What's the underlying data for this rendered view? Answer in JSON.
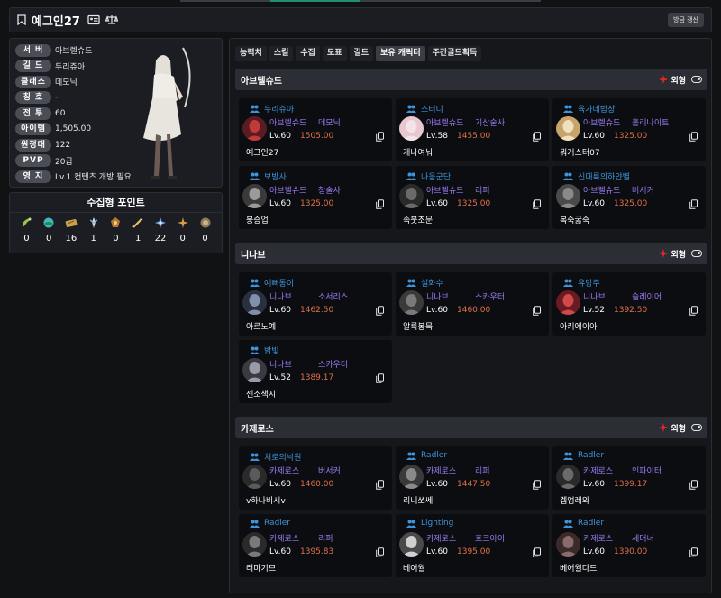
{
  "header": {
    "title": "예그인27",
    "refresh_label": "방금 갱신"
  },
  "profile": {
    "rows": [
      {
        "label": "서 버",
        "value": "아브렐슈드"
      },
      {
        "label": "길 드",
        "value": "두리쥬아"
      },
      {
        "label": "클래스",
        "value": "데모닉"
      },
      {
        "label": "칭 호",
        "value": "-"
      },
      {
        "label": "전 투",
        "value": "60"
      },
      {
        "label": "아이템",
        "value": "1,505.00"
      },
      {
        "label": "원정대",
        "value": "122"
      },
      {
        "label": "PVP",
        "value": "20급"
      },
      {
        "label": "영 지",
        "value": "Lv.1 컨텐츠 개방 필요"
      }
    ]
  },
  "collect": {
    "title": "수집형 포인트",
    "items": [
      {
        "icon": "mokoko-seed-icon",
        "count": "0"
      },
      {
        "icon": "island-heart-icon",
        "count": "0"
      },
      {
        "icon": "art-scroll-icon",
        "count": "16"
      },
      {
        "icon": "giant-heart-icon",
        "count": "1"
      },
      {
        "icon": "ignea-token-icon",
        "count": "0"
      },
      {
        "icon": "adventure-book-icon",
        "count": "1"
      },
      {
        "icon": "world-tree-leaf-icon",
        "count": "22"
      },
      {
        "icon": "omnium-star-icon",
        "count": "0"
      },
      {
        "icon": "orpheus-star-icon",
        "count": "0"
      }
    ]
  },
  "tabs": [
    "능력치",
    "스킬",
    "수집",
    "도표",
    "길드",
    "보유 캐릭터",
    "주간골드획득"
  ],
  "active_tab": "보유 캐릭터",
  "look_label": "외형",
  "colors": {
    "guild": "#3f94d9",
    "server_class": "#9a7cf5",
    "item_level": "#e0704a"
  },
  "servers": [
    {
      "name": "아브렐슈드",
      "characters": [
        {
          "guild": "두리쥬아",
          "server": "아브렐슈드",
          "class": "데모닉",
          "level": "Lv.60",
          "item_level": "1505.00",
          "name": "예그인27"
        },
        {
          "guild": "스터디",
          "server": "아브렐슈드",
          "class": "기상술사",
          "level": "Lv.58",
          "item_level": "1455.00",
          "name": "개나여눠"
        },
        {
          "guild": "육가네밥상",
          "server": "아브렐슈드",
          "class": "홀리나이트",
          "level": "Lv.60",
          "item_level": "1325.00",
          "name": "뭐거스터07"
        },
        {
          "guild": "보방사",
          "server": "아브렐슈드",
          "class": "창술사",
          "level": "Lv.60",
          "item_level": "1325.00",
          "name": "붕승업"
        },
        {
          "guild": "나응군단",
          "server": "아브렐슈드",
          "class": "리퍼",
          "level": "Lv.60",
          "item_level": "1325.00",
          "name": "속붓조문"
        },
        {
          "guild": "신대륙의하얀별",
          "server": "아브렐슈드",
          "class": "버서커",
          "level": "Lv.60",
          "item_level": "1325.00",
          "name": "복숙굶숙"
        }
      ]
    },
    {
      "name": "니나브",
      "characters": [
        {
          "guild": "예뻐동이",
          "server": "니나브",
          "class": "소서리스",
          "level": "Lv.60",
          "item_level": "1462.50",
          "name": "아르노예"
        },
        {
          "guild": "설화수",
          "server": "니나브",
          "class": "스카우터",
          "level": "Lv.60",
          "item_level": "1460.00",
          "name": "알륵봉묵"
        },
        {
          "guild": "유망주",
          "server": "니나브",
          "class": "슬레이어",
          "level": "Lv.52",
          "item_level": "1392.50",
          "name": "아키에이아"
        },
        {
          "guild": "밤빛",
          "server": "니나브",
          "class": "스카우터",
          "level": "Lv.52",
          "item_level": "1389.17",
          "name": "젠소색시"
        }
      ]
    },
    {
      "name": "카제로스",
      "characters": [
        {
          "guild": "처로의낙원",
          "server": "카제로스",
          "class": "버서커",
          "level": "Lv.60",
          "item_level": "1460.00",
          "name": "v하나비시v"
        },
        {
          "guild": "Radler",
          "server": "카제로스",
          "class": "리퍼",
          "level": "Lv.60",
          "item_level": "1447.50",
          "name": "리니쏘쎄"
        },
        {
          "guild": "Radler",
          "server": "카제로스",
          "class": "인파이터",
          "level": "Lv.60",
          "item_level": "1399.17",
          "name": "겝엄레와"
        },
        {
          "guild": "Radler",
          "server": "카제로스",
          "class": "리퍼",
          "level": "Lv.60",
          "item_level": "1395.83",
          "name": "러마기므"
        },
        {
          "guild": "Lighting",
          "server": "카제로스",
          "class": "호크아이",
          "level": "Lv.60",
          "item_level": "1395.00",
          "name": "베어월"
        },
        {
          "guild": "Radler",
          "server": "카제로스",
          "class": "세머너",
          "level": "Lv.60",
          "item_level": "1390.00",
          "name": "베어월다드"
        }
      ]
    }
  ]
}
